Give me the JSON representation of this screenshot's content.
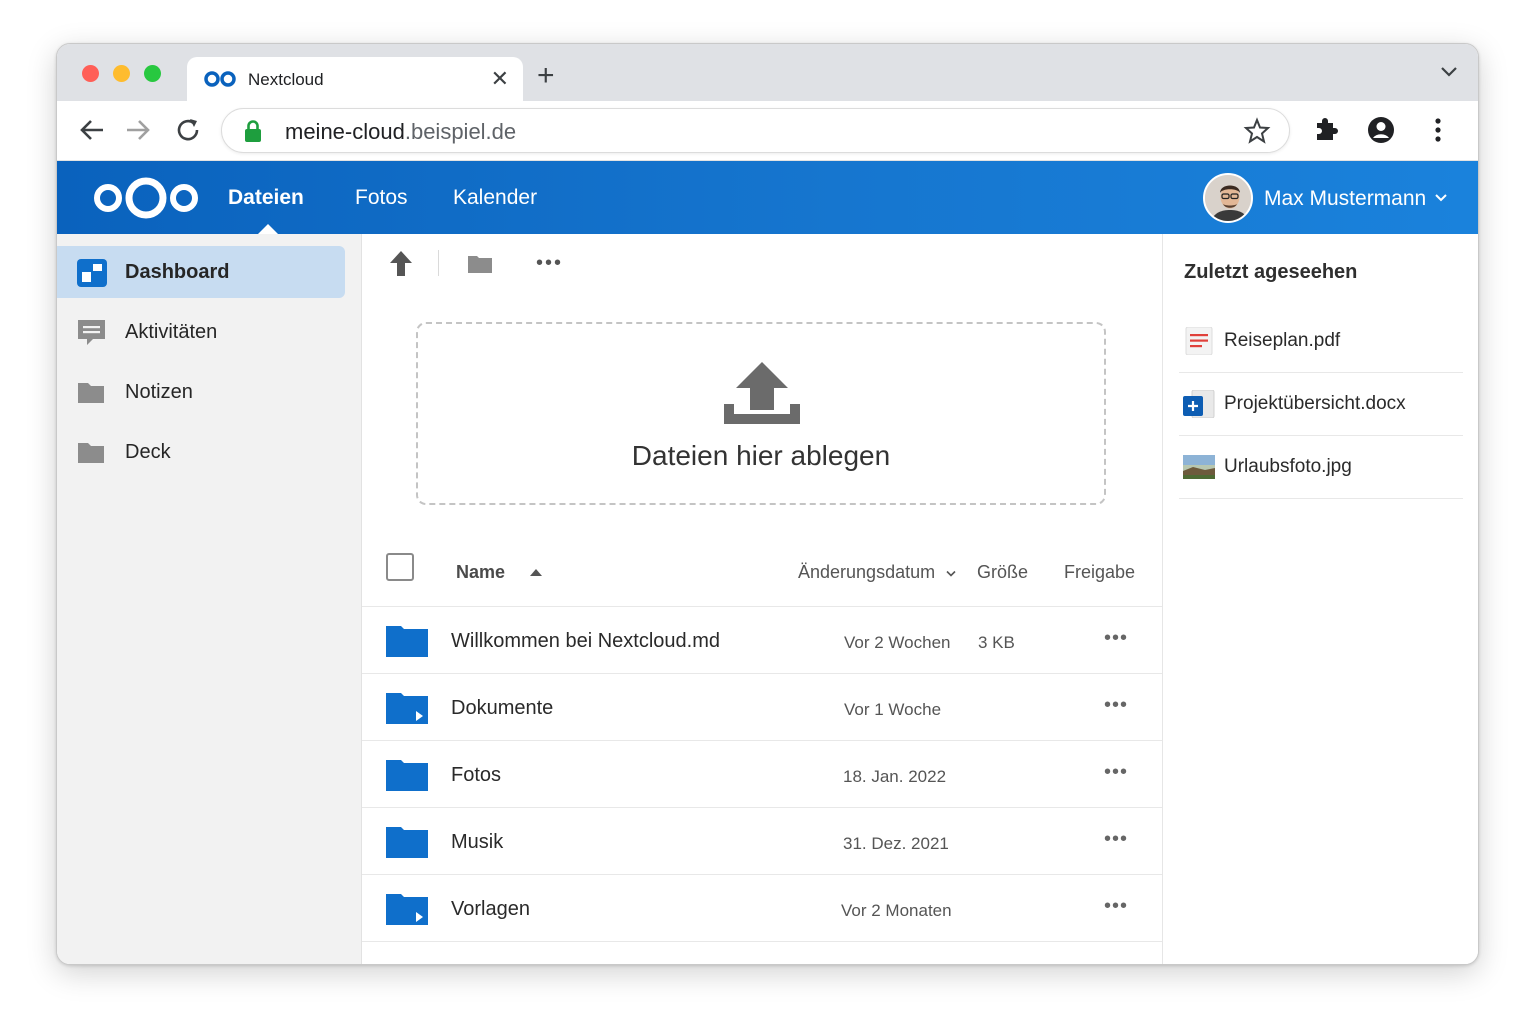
{
  "browser": {
    "tab_title": "Nextcloud",
    "url_main": "meine-cloud",
    "url_rest": ".beispiel.de"
  },
  "header": {
    "nav": [
      "Dateien",
      "Fotos",
      "Kalender"
    ],
    "user_name": "Max Mustermann"
  },
  "sidebar": {
    "items": [
      {
        "label": "Dashboard",
        "icon": "dashboard-icon",
        "active": true
      },
      {
        "label": "Aktivitäten",
        "icon": "activity-icon",
        "active": false
      },
      {
        "label": "Notizen",
        "icon": "folder-icon",
        "active": false
      },
      {
        "label": "Deck",
        "icon": "folder-icon",
        "active": false
      }
    ]
  },
  "main": {
    "dropzone_text": "Dateien hier ablegen",
    "columns": {
      "name": "Name",
      "modified": "Änderungsdatum",
      "size": "Größe",
      "share": "Freigabe"
    },
    "files": [
      {
        "name": "Willkommen bei Nextcloud.md",
        "modified": "Vor 2 Wochen",
        "size": "3 KB",
        "shared": false
      },
      {
        "name": "Dokumente",
        "modified": "Vor 1 Woche",
        "size": "",
        "shared": true
      },
      {
        "name": "Fotos",
        "modified": "18. Jan. 2022",
        "size": "",
        "shared": false
      },
      {
        "name": "Musik",
        "modified": "31. Dez. 2021",
        "size": "",
        "shared": false
      },
      {
        "name": "Vorlagen",
        "modified": "Vor 2 Monaten",
        "size": "",
        "shared": true
      }
    ],
    "more_label": "•••"
  },
  "recent": {
    "title": "Zuletzt ageseehen",
    "items": [
      {
        "label": "Reiseplan.pdf",
        "icon": "pdf-icon"
      },
      {
        "label": "Projektübersicht.docx",
        "icon": "docx-icon"
      },
      {
        "label": "Urlaubsfoto.jpg",
        "icon": "image-thumbnail-icon"
      }
    ]
  },
  "colors": {
    "brand": "#0a62bd",
    "folder": "#0f6fcb",
    "active_bg": "#c7dcf1"
  }
}
